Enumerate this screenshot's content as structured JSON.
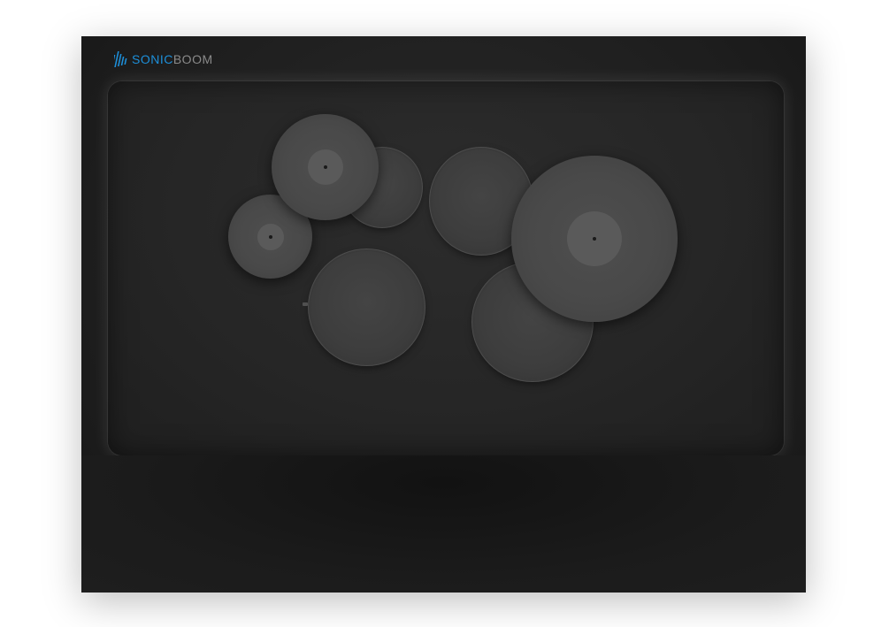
{
  "app": {
    "logo": {
      "sonic": "SONIC",
      "boom": "BOOM",
      "accent_color": "#1d8fd9",
      "secondary_color": "#8a8a8a",
      "icon": "sound-bars-icon"
    }
  },
  "kit": {
    "pads": [
      {
        "id": "tom-1",
        "kind": "drum"
      },
      {
        "id": "tom-2",
        "kind": "drum"
      },
      {
        "id": "snare",
        "kind": "drum"
      },
      {
        "id": "floor-tom",
        "kind": "drum"
      },
      {
        "id": "hi-hat",
        "kind": "cymbal"
      },
      {
        "id": "crash",
        "kind": "cymbal"
      },
      {
        "id": "ride",
        "kind": "cymbal"
      }
    ]
  }
}
